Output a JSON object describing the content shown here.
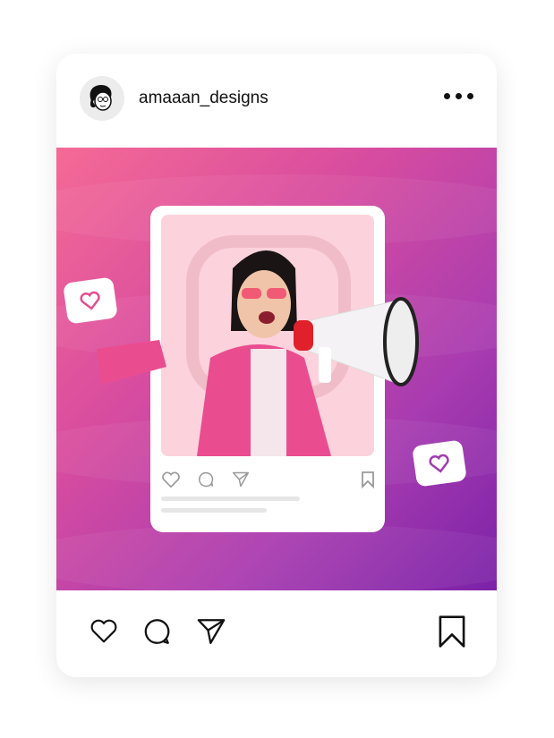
{
  "post": {
    "username": "amaaan_designs",
    "colors": {
      "gradient_start": "#f56a95",
      "gradient_end": "#7b22a8",
      "heart_purple": "#a03cb0"
    },
    "icons": [
      "avatar",
      "more-icon",
      "heart-icon",
      "comment-icon",
      "send-icon",
      "bookmark-icon"
    ]
  }
}
